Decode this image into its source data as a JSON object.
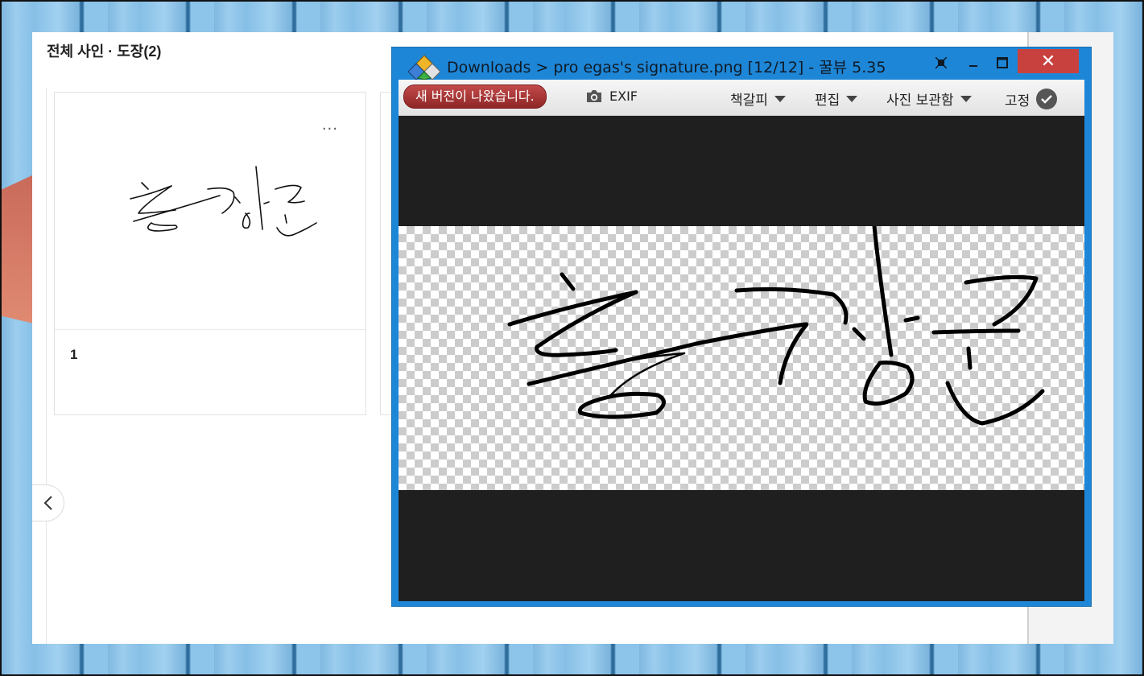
{
  "webpage": {
    "title": "전체 사인 · 도장(2)",
    "cards": [
      {
        "label": "1",
        "more": "..."
      }
    ]
  },
  "viewer": {
    "title": "Downloads > pro egas's signature.png [12/12] - 꿀뷰 5.35",
    "new_version": "새 버전이 나왔습니다.",
    "exif_label": "EXIF",
    "menus": {
      "bookmark": "책갈피",
      "edit": "편집",
      "storage": "사진 보관함",
      "pin": "고정"
    },
    "close_glyph": "✕"
  },
  "colors": {
    "viewer_frame": "#1e86d6",
    "close_button": "#c9413f",
    "new_version_badge": "#a83636",
    "canvas_bg": "#1f1f1f"
  },
  "icons": [
    "app-logo-icon",
    "fit-icon",
    "minimize-icon",
    "maximize-icon",
    "close-icon",
    "camera-icon",
    "check-icon",
    "chevron-left-icon",
    "more-icon"
  ]
}
